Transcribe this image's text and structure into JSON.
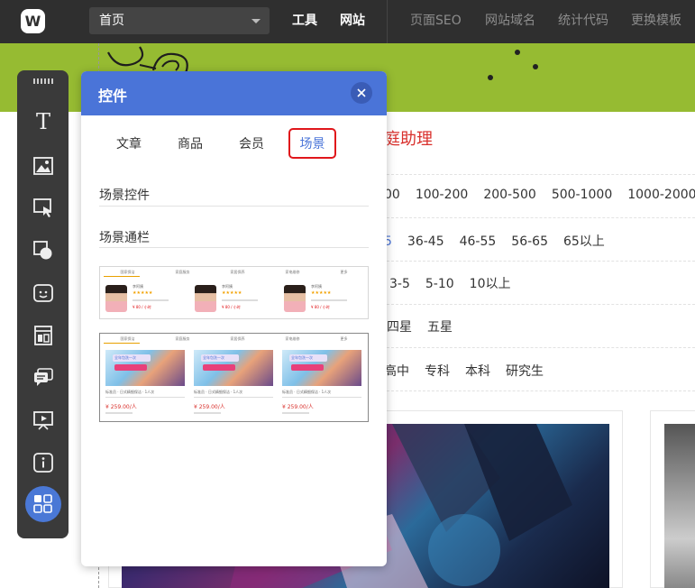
{
  "topbar": {
    "logo_letter": "W",
    "page_select_value": "首页",
    "nav_primary": [
      "工具",
      "网站"
    ],
    "nav_secondary": [
      "页面SEO",
      "网站域名",
      "统计代码",
      "更换模板"
    ]
  },
  "canvas": {
    "heading_fragment": "庭助理",
    "filter_rows": [
      [
        "00",
        "100-200",
        "200-500",
        "500-1000",
        "1000-2000"
      ],
      [
        "5",
        "36-45",
        "46-55",
        "56-65",
        "65以上"
      ],
      [
        "3-5",
        "5-10",
        "10以上"
      ],
      [
        "四星",
        "五星"
      ],
      [
        "高中",
        "专科",
        "本科",
        "研究生"
      ]
    ]
  },
  "toolbar": {
    "items": [
      "text-icon",
      "image-icon",
      "pointer-icon",
      "shape-icon",
      "face-icon",
      "layout-icon",
      "chat-icon",
      "slideshow-icon",
      "info-icon",
      "grid-icon"
    ],
    "text_glyph": "T"
  },
  "panel": {
    "title": "控件",
    "tabs": [
      "文章",
      "商品",
      "会员",
      "场景"
    ],
    "active_tab": "场景",
    "sections": [
      "场景控件",
      "场景通栏"
    ]
  },
  "thumb1": {
    "tabs": [
      "国家保洁",
      "家庭服务",
      "家居保养",
      "家电维修",
      "更多"
    ],
    "cards": [
      {
        "name": "李阿姨",
        "stars": "★★★★★",
        "price": "¥ 80 / 小时"
      },
      {
        "name": "李阿姨",
        "stars": "★★★★★",
        "price": "¥ 80 / 小时"
      },
      {
        "name": "李阿姨",
        "stars": "★★★★★",
        "price": "¥ 80 / 小时"
      }
    ]
  },
  "thumb2": {
    "tabs": [
      "国家保洁",
      "家庭服务",
      "家居保养",
      "家电维修",
      "更多"
    ],
    "cards": [
      {
        "banner": "全年包洗一次",
        "desc": "标准员 · 日式精细保洁 · 1人次",
        "price": "¥ 259.00/人"
      },
      {
        "banner": "全年包洗一次",
        "desc": "标准员 · 日式精细保洁 · 1人次",
        "price": "¥ 259.00/人"
      },
      {
        "banner": "全年包洗一次",
        "desc": "标准员 · 日式精细保洁 · 1人次",
        "price": "¥ 259.00/人"
      }
    ]
  },
  "colors": {
    "topbar_bg": "#2f2f2f",
    "green_band": "#96bb32",
    "panel_header": "#4a74d8",
    "highlight_red": "#e0161b",
    "heading_red": "#d9302c"
  }
}
